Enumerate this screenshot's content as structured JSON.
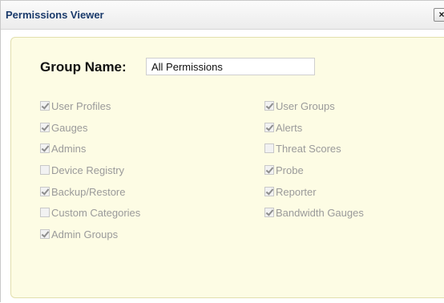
{
  "dialog": {
    "title": "Permissions Viewer",
    "close_label": "×"
  },
  "group": {
    "label": "Group Name:",
    "value": "All Permissions"
  },
  "permissions": {
    "left": [
      {
        "label": "User Profiles",
        "checked": true
      },
      {
        "label": "Gauges",
        "checked": true
      },
      {
        "label": "Admins",
        "checked": true
      },
      {
        "label": "Device Registry",
        "checked": false
      },
      {
        "label": "Backup/Restore",
        "checked": true
      },
      {
        "label": "Custom Categories",
        "checked": false
      },
      {
        "label": "Admin Groups",
        "checked": true
      }
    ],
    "right": [
      {
        "label": "User Groups",
        "checked": true
      },
      {
        "label": "Alerts",
        "checked": true
      },
      {
        "label": "Threat Scores",
        "checked": false
      },
      {
        "label": "Probe",
        "checked": true
      },
      {
        "label": "Reporter",
        "checked": true
      },
      {
        "label": "Bandwidth Gauges",
        "checked": true
      }
    ]
  }
}
